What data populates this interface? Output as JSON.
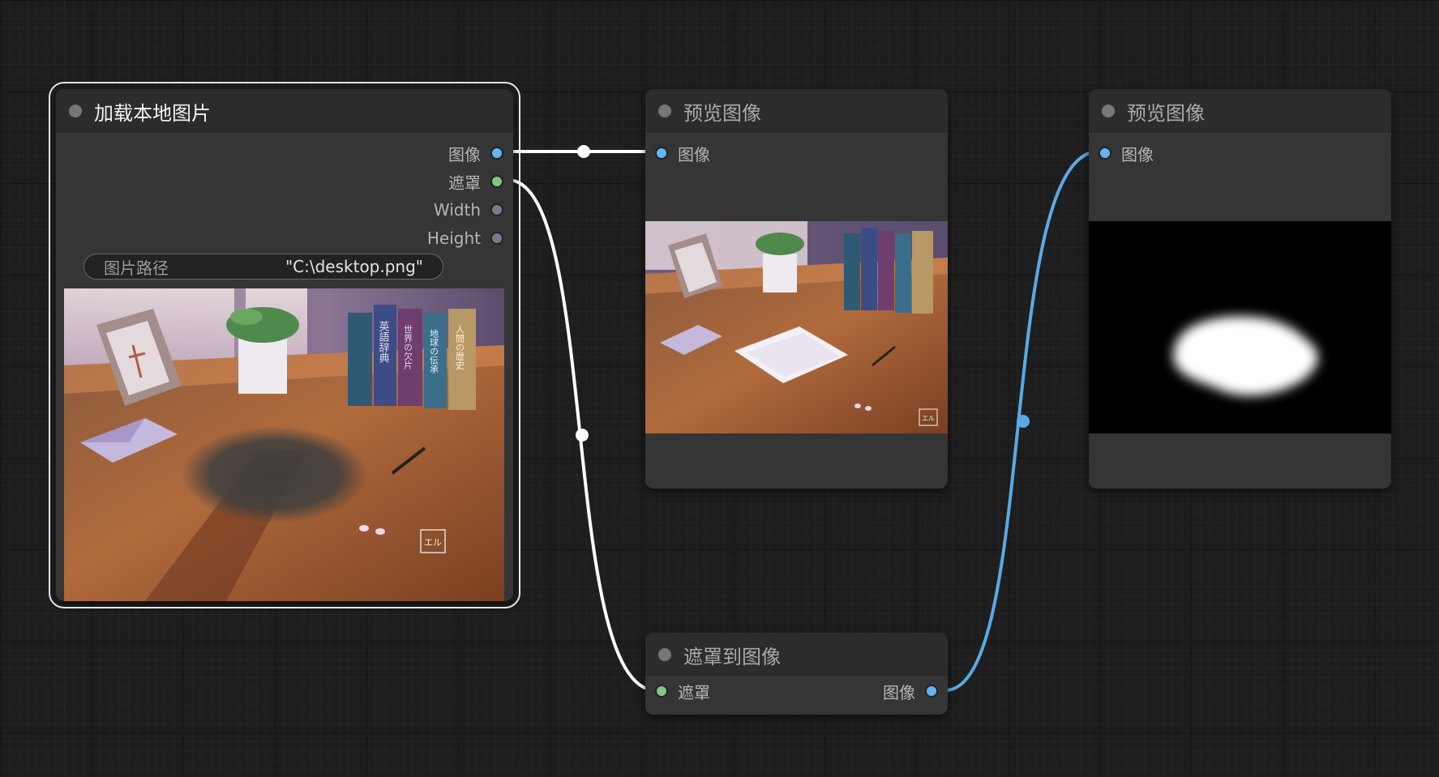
{
  "nodes": {
    "load_image": {
      "title": "加载本地图片",
      "outputs": [
        {
          "label": "图像",
          "type": "image"
        },
        {
          "label": "遮罩",
          "type": "mask"
        },
        {
          "label": "Width",
          "type": "int"
        },
        {
          "label": "Height",
          "type": "int"
        }
      ],
      "widget": {
        "label": "图片路径",
        "value": "\"C:\\desktop.png\""
      }
    },
    "preview_1": {
      "title": "预览图像",
      "inputs": [
        {
          "label": "图像",
          "type": "image"
        }
      ]
    },
    "preview_2": {
      "title": "预览图像",
      "inputs": [
        {
          "label": "图像",
          "type": "image"
        }
      ]
    },
    "mask_to_image": {
      "title": "遮罩到图像",
      "inputs": [
        {
          "label": "遮罩",
          "type": "mask"
        }
      ],
      "outputs": [
        {
          "label": "图像",
          "type": "image"
        }
      ]
    }
  },
  "image_content": {
    "badge_text": "エル",
    "book_titles": [
      "英語辞典",
      "世界の欠片",
      "地球の伝承",
      "人間の歴史"
    ]
  },
  "colors": {
    "canvas": "#1d1d1d",
    "node_body": "#353535",
    "node_header": "#2c2c2c",
    "image_socket": "#64b5f6",
    "mask_socket": "#81c784",
    "int_socket": "#7a7a8a",
    "link_white": "#ffffff",
    "link_blue": "#5aa9e6"
  }
}
